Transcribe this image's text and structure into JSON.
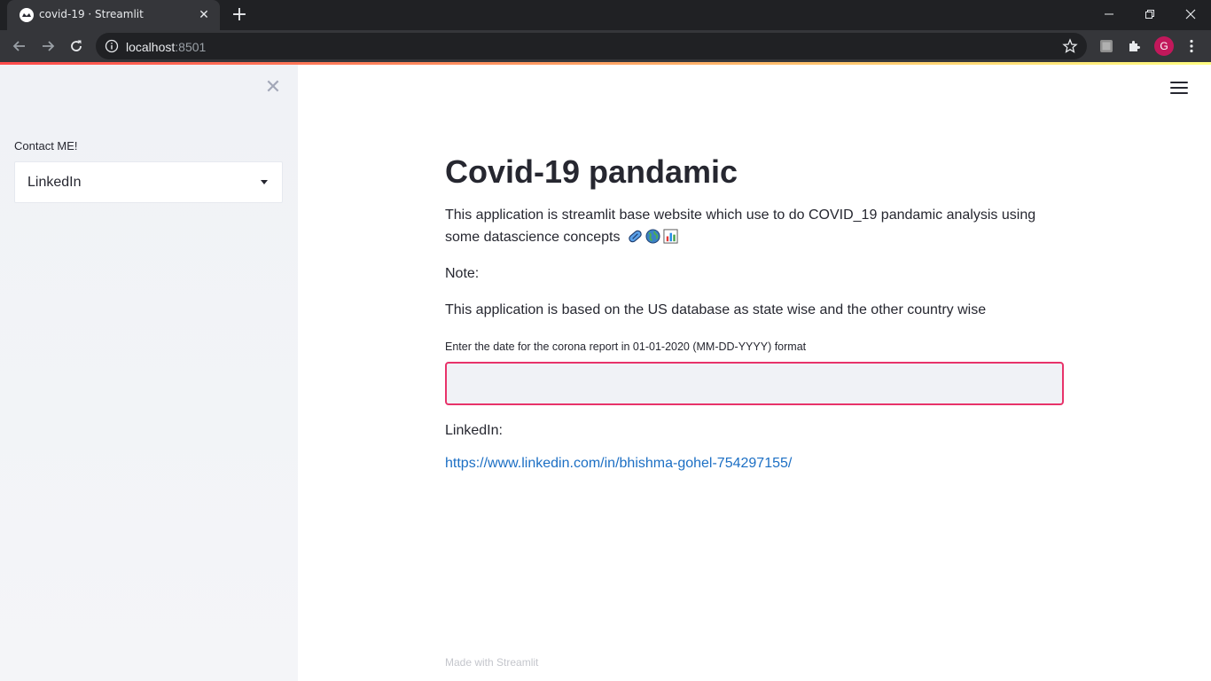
{
  "browser": {
    "tab_title": "covid-19 · Streamlit",
    "url_host": "localhost",
    "url_port": ":8501",
    "profile_initial": "G",
    "accent_color": "#c2185b"
  },
  "sidebar": {
    "label": "Contact ME!",
    "select_value": "LinkedIn"
  },
  "main": {
    "title": "Covid-19 pandamic",
    "description": "This application is streamlit base website which use to do COVID_19 pandamic analysis using some datascience concepts",
    "description_emojis": [
      "pill-icon",
      "globe-icon",
      "bar-chart-icon"
    ],
    "note_label": "Note:",
    "note_text": "This application is based on the US database as state wise and the other country wise",
    "date_input_label": "Enter the date for the corona report in 01-01-2020 (MM-DD-YYYY) format",
    "date_input_value": "",
    "linkedin_label": "LinkedIn:",
    "linkedin_url": "https://www.linkedin.com/in/bhishma-gohel-754297155/",
    "footer": "Made with Streamlit"
  },
  "colors": {
    "input_border": "#e8336a",
    "link": "#1c6fc4",
    "sidebar_bg": "#f0f2f6"
  }
}
